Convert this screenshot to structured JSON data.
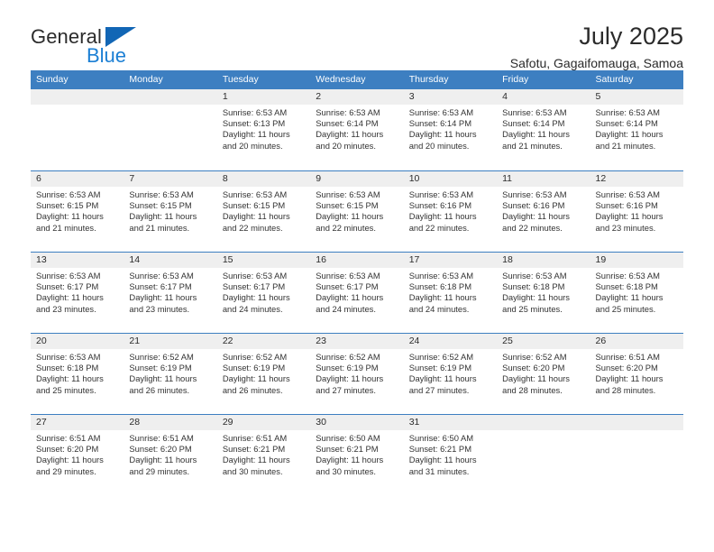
{
  "brand": {
    "name_top": "General",
    "name_bottom": "Blue",
    "triangle_color": "#1266b5",
    "blue_color": "#1b7fd4"
  },
  "header": {
    "title": "July 2025",
    "subtitle": "Safotu, Gagaifomauga, Samoa"
  },
  "theme": {
    "header_blue": "#3d7fc1",
    "band_gray": "#efefef",
    "text": "#2b2b2b"
  },
  "calendar": {
    "weekday_headers": [
      "Sunday",
      "Monday",
      "Tuesday",
      "Wednesday",
      "Thursday",
      "Friday",
      "Saturday"
    ],
    "weeks": [
      [
        {
          "day": "",
          "empty": true
        },
        {
          "day": "",
          "empty": true
        },
        {
          "day": "1",
          "sunrise": "Sunrise: 6:53 AM",
          "sunset": "Sunset: 6:13 PM",
          "daylight": "Daylight: 11 hours and 20 minutes."
        },
        {
          "day": "2",
          "sunrise": "Sunrise: 6:53 AM",
          "sunset": "Sunset: 6:14 PM",
          "daylight": "Daylight: 11 hours and 20 minutes."
        },
        {
          "day": "3",
          "sunrise": "Sunrise: 6:53 AM",
          "sunset": "Sunset: 6:14 PM",
          "daylight": "Daylight: 11 hours and 20 minutes."
        },
        {
          "day": "4",
          "sunrise": "Sunrise: 6:53 AM",
          "sunset": "Sunset: 6:14 PM",
          "daylight": "Daylight: 11 hours and 21 minutes."
        },
        {
          "day": "5",
          "sunrise": "Sunrise: 6:53 AM",
          "sunset": "Sunset: 6:14 PM",
          "daylight": "Daylight: 11 hours and 21 minutes."
        }
      ],
      [
        {
          "day": "6",
          "sunrise": "Sunrise: 6:53 AM",
          "sunset": "Sunset: 6:15 PM",
          "daylight": "Daylight: 11 hours and 21 minutes."
        },
        {
          "day": "7",
          "sunrise": "Sunrise: 6:53 AM",
          "sunset": "Sunset: 6:15 PM",
          "daylight": "Daylight: 11 hours and 21 minutes."
        },
        {
          "day": "8",
          "sunrise": "Sunrise: 6:53 AM",
          "sunset": "Sunset: 6:15 PM",
          "daylight": "Daylight: 11 hours and 22 minutes."
        },
        {
          "day": "9",
          "sunrise": "Sunrise: 6:53 AM",
          "sunset": "Sunset: 6:15 PM",
          "daylight": "Daylight: 11 hours and 22 minutes."
        },
        {
          "day": "10",
          "sunrise": "Sunrise: 6:53 AM",
          "sunset": "Sunset: 6:16 PM",
          "daylight": "Daylight: 11 hours and 22 minutes."
        },
        {
          "day": "11",
          "sunrise": "Sunrise: 6:53 AM",
          "sunset": "Sunset: 6:16 PM",
          "daylight": "Daylight: 11 hours and 22 minutes."
        },
        {
          "day": "12",
          "sunrise": "Sunrise: 6:53 AM",
          "sunset": "Sunset: 6:16 PM",
          "daylight": "Daylight: 11 hours and 23 minutes."
        }
      ],
      [
        {
          "day": "13",
          "sunrise": "Sunrise: 6:53 AM",
          "sunset": "Sunset: 6:17 PM",
          "daylight": "Daylight: 11 hours and 23 minutes."
        },
        {
          "day": "14",
          "sunrise": "Sunrise: 6:53 AM",
          "sunset": "Sunset: 6:17 PM",
          "daylight": "Daylight: 11 hours and 23 minutes."
        },
        {
          "day": "15",
          "sunrise": "Sunrise: 6:53 AM",
          "sunset": "Sunset: 6:17 PM",
          "daylight": "Daylight: 11 hours and 24 minutes."
        },
        {
          "day": "16",
          "sunrise": "Sunrise: 6:53 AM",
          "sunset": "Sunset: 6:17 PM",
          "daylight": "Daylight: 11 hours and 24 minutes."
        },
        {
          "day": "17",
          "sunrise": "Sunrise: 6:53 AM",
          "sunset": "Sunset: 6:18 PM",
          "daylight": "Daylight: 11 hours and 24 minutes."
        },
        {
          "day": "18",
          "sunrise": "Sunrise: 6:53 AM",
          "sunset": "Sunset: 6:18 PM",
          "daylight": "Daylight: 11 hours and 25 minutes."
        },
        {
          "day": "19",
          "sunrise": "Sunrise: 6:53 AM",
          "sunset": "Sunset: 6:18 PM",
          "daylight": "Daylight: 11 hours and 25 minutes."
        }
      ],
      [
        {
          "day": "20",
          "sunrise": "Sunrise: 6:53 AM",
          "sunset": "Sunset: 6:18 PM",
          "daylight": "Daylight: 11 hours and 25 minutes."
        },
        {
          "day": "21",
          "sunrise": "Sunrise: 6:52 AM",
          "sunset": "Sunset: 6:19 PM",
          "daylight": "Daylight: 11 hours and 26 minutes."
        },
        {
          "day": "22",
          "sunrise": "Sunrise: 6:52 AM",
          "sunset": "Sunset: 6:19 PM",
          "daylight": "Daylight: 11 hours and 26 minutes."
        },
        {
          "day": "23",
          "sunrise": "Sunrise: 6:52 AM",
          "sunset": "Sunset: 6:19 PM",
          "daylight": "Daylight: 11 hours and 27 minutes."
        },
        {
          "day": "24",
          "sunrise": "Sunrise: 6:52 AM",
          "sunset": "Sunset: 6:19 PM",
          "daylight": "Daylight: 11 hours and 27 minutes."
        },
        {
          "day": "25",
          "sunrise": "Sunrise: 6:52 AM",
          "sunset": "Sunset: 6:20 PM",
          "daylight": "Daylight: 11 hours and 28 minutes."
        },
        {
          "day": "26",
          "sunrise": "Sunrise: 6:51 AM",
          "sunset": "Sunset: 6:20 PM",
          "daylight": "Daylight: 11 hours and 28 minutes."
        }
      ],
      [
        {
          "day": "27",
          "sunrise": "Sunrise: 6:51 AM",
          "sunset": "Sunset: 6:20 PM",
          "daylight": "Daylight: 11 hours and 29 minutes."
        },
        {
          "day": "28",
          "sunrise": "Sunrise: 6:51 AM",
          "sunset": "Sunset: 6:20 PM",
          "daylight": "Daylight: 11 hours and 29 minutes."
        },
        {
          "day": "29",
          "sunrise": "Sunrise: 6:51 AM",
          "sunset": "Sunset: 6:21 PM",
          "daylight": "Daylight: 11 hours and 30 minutes."
        },
        {
          "day": "30",
          "sunrise": "Sunrise: 6:50 AM",
          "sunset": "Sunset: 6:21 PM",
          "daylight": "Daylight: 11 hours and 30 minutes."
        },
        {
          "day": "31",
          "sunrise": "Sunrise: 6:50 AM",
          "sunset": "Sunset: 6:21 PM",
          "daylight": "Daylight: 11 hours and 31 minutes."
        },
        {
          "day": "",
          "empty": true
        },
        {
          "day": "",
          "empty": true
        }
      ]
    ]
  }
}
